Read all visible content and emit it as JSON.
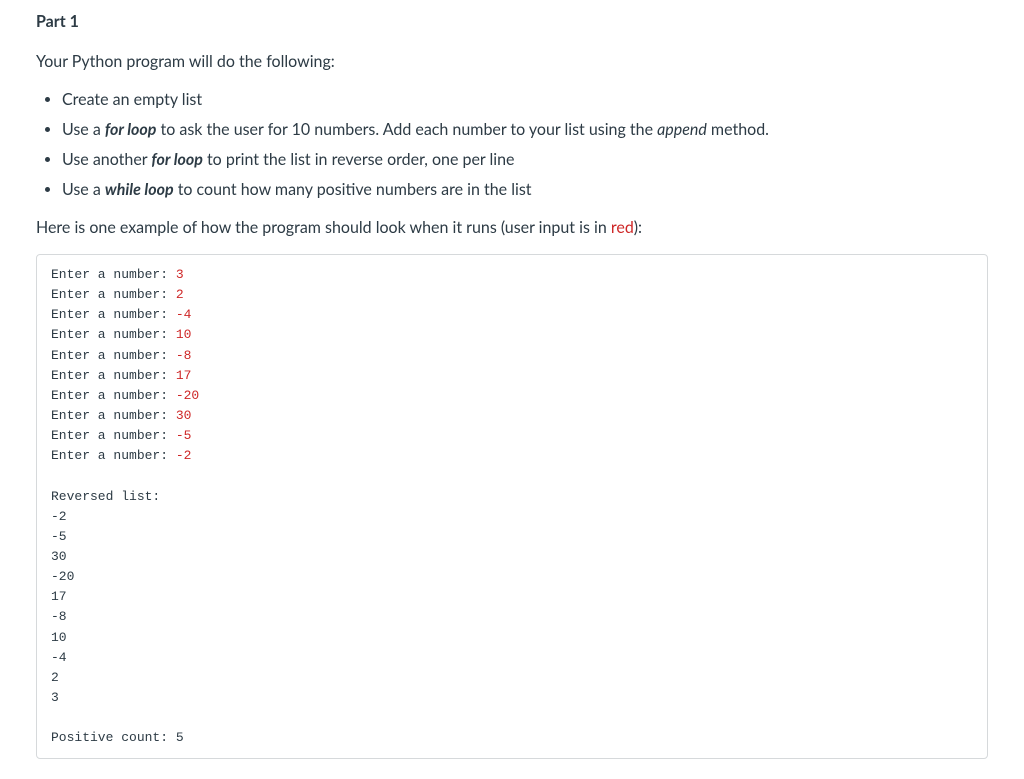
{
  "part_title": "Part 1",
  "intro": "Your Python program will do the following:",
  "bullets": {
    "b1_text": "Create an empty list",
    "b2_pre": "Use a ",
    "b2_forloop": "for loop",
    "b2_mid": " to ask the user for 10 numbers. Add each number to your list using the ",
    "b2_append": "append",
    "b2_post": " method.",
    "b3_pre": "Use another ",
    "b3_forloop": "for loop",
    "b3_post": " to print the list in reverse order, one per line",
    "b4_pre": "Use a ",
    "b4_whileloop": "while loop",
    "b4_post": " to count how many positive numbers are in the list"
  },
  "example_intro_pre": "Here is one example of how the program should look when it runs (user input is in ",
  "example_intro_red": "red",
  "example_intro_post": "):",
  "console": {
    "prompt": "Enter a number: ",
    "inputs": [
      "3",
      "2",
      "-4",
      "10",
      "-8",
      "17",
      "-20",
      "30",
      "-5",
      "-2"
    ],
    "reversed_label": "Reversed list:",
    "reversed_values": [
      "-2",
      "-5",
      "30",
      "-20",
      "17",
      "-8",
      "10",
      "-4",
      "2",
      "3"
    ],
    "positive_label": "Positive count: ",
    "positive_value": "5"
  }
}
